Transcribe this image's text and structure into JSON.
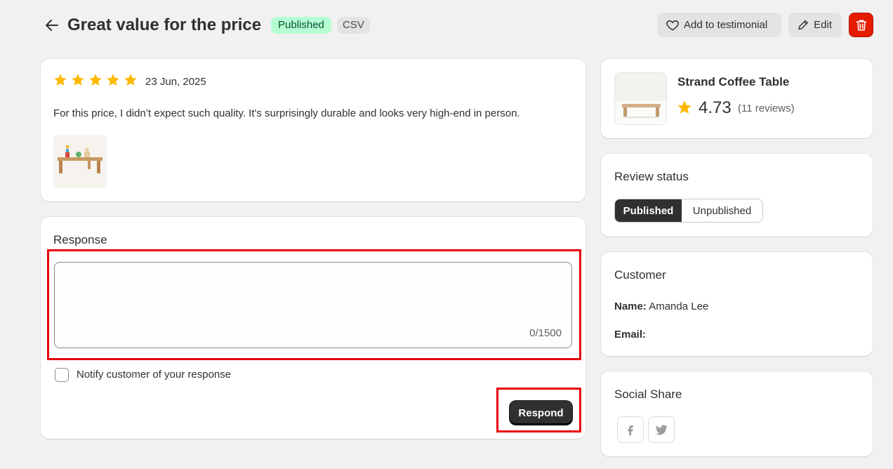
{
  "header": {
    "title": "Great value for the price",
    "status_badge": "Published",
    "source_badge": "CSV",
    "add_testimonial_label": "Add to testimonial",
    "edit_label": "Edit"
  },
  "review": {
    "rating": 5,
    "date": "23 Jun, 2025",
    "text": "For this price, I didn’t expect such quality. It's surprisingly durable and looks very high-end in person."
  },
  "response": {
    "title": "Response",
    "value": "",
    "char_count": "0/1500",
    "notify_label": "Notify customer of your response",
    "respond_label": "Respond"
  },
  "product": {
    "name": "Strand Coffee Table",
    "rating": "4.73",
    "reviews": "(11 reviews)"
  },
  "review_status": {
    "title": "Review status",
    "options": [
      "Published",
      "Unpublished"
    ],
    "selected": "Published"
  },
  "customer": {
    "title": "Customer",
    "name_label": "Name:",
    "name_value": "Amanda Lee",
    "email_label": "Email:",
    "email_value": ""
  },
  "social": {
    "title": "Social Share",
    "icons": [
      "facebook-icon",
      "twitter-icon"
    ]
  },
  "colors": {
    "star": "#ffb800",
    "published_badge_bg": "#b4fed2",
    "delete_bg": "#e51c00",
    "highlight": "#e8000b",
    "primary_button": "#303030"
  }
}
